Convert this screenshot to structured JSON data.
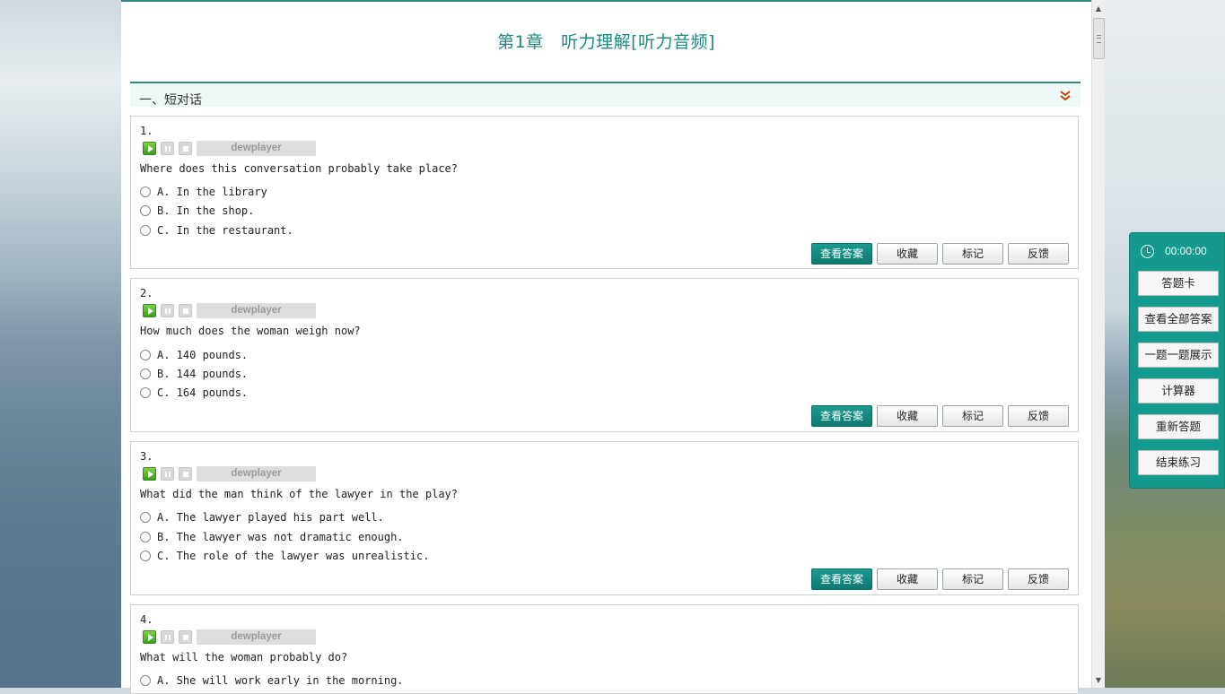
{
  "chapter_title": "第1章　听力理解[听力音频]",
  "section": {
    "title": "一、短对话"
  },
  "player_label": "dewplayer",
  "actions": {
    "view_answer": "查看答案",
    "favorite": "收藏",
    "mark": "标记",
    "feedback": "反馈"
  },
  "questions": [
    {
      "num": "1.",
      "text": "Where does this conversation probably take place?",
      "options": [
        "A. In the library",
        "B. In the shop.",
        "C. In the restaurant."
      ]
    },
    {
      "num": "2.",
      "text": "How much does the woman weigh now?",
      "options": [
        "A. 140 pounds.",
        "B. 144 pounds.",
        "C. 164 pounds."
      ]
    },
    {
      "num": "3.",
      "text": "What did the man think of the lawyer in the play?",
      "options": [
        "A. The lawyer played his part well.",
        "B. The lawyer was not dramatic enough.",
        "C. The role of the lawyer was unrealistic."
      ]
    },
    {
      "num": "4.",
      "text": "What will the woman probably do?",
      "options": [
        "A. She will work early in the morning."
      ]
    }
  ],
  "panel": {
    "timer": "00:00:00",
    "buttons": [
      "答题卡",
      "查看全部答案",
      "一题一题展示",
      "计算器",
      "重新答题",
      "结束练习"
    ]
  },
  "icons": {
    "section_toggle": "double-chevron-down-icon",
    "play": "play-icon",
    "pause": "pause-icon",
    "stop": "stop-icon",
    "timer": "clock-icon"
  },
  "colors": {
    "accent": "#1a8a80",
    "primary_button": "#0d7a70",
    "panel": "#139a8c",
    "toggle": "#c04000"
  }
}
